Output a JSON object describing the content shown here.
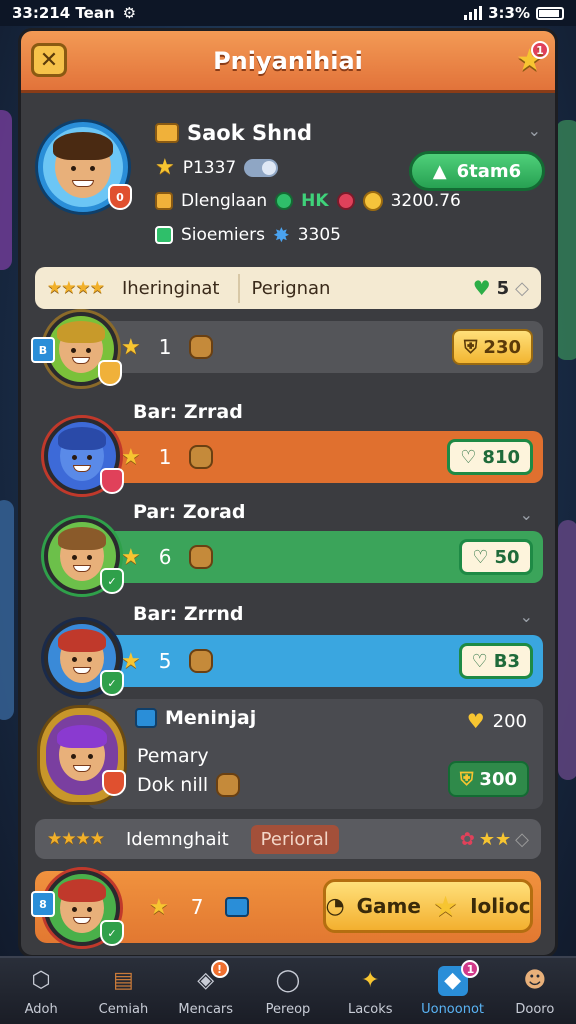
{
  "status_bar": {
    "time": "33:214 Tean",
    "battery": "3:3%"
  },
  "header": {
    "title": "Pniyanihiai",
    "notification_count": "1"
  },
  "profile": {
    "name": "Saok Shnd",
    "points": "P1337",
    "guild_label": "Dlenglaan",
    "gems_text": "HK",
    "gold": "3200.76",
    "shield_label": "Sioemiers",
    "stars_count": "3305",
    "action_label": "6tam6"
  },
  "tabs_top": {
    "stars": "★★★★",
    "label_a": "Iheringinat",
    "label_b": "Perignan",
    "count": "5"
  },
  "rows": [
    {
      "name": "",
      "rank": "1",
      "value": "230",
      "color": "#545559",
      "pill": "gold",
      "badge_text": "B"
    },
    {
      "name": "Bar: Zrrad",
      "rank": "1",
      "value": "810",
      "color": "#e0702f",
      "pill": "white"
    },
    {
      "name": "Par: Zorad",
      "rank": "6",
      "value": "50",
      "color": "#3ba45a",
      "pill": "white"
    },
    {
      "name": "Bar: Zrrnd",
      "rank": "5",
      "value": "B3",
      "color": "#3aa6e0",
      "pill": "white"
    }
  ],
  "featured": {
    "name": "Meninjaj",
    "line1": "Pemary",
    "line2": "Dok nill",
    "gold": "200",
    "value": "300"
  },
  "tabs_bottom": {
    "stars": "★★★★",
    "label_a": "Idemnghait",
    "label_b": "Perioral"
  },
  "footer_row": {
    "rank": "7",
    "button_left": "Game",
    "button_right": "Iolioc",
    "badge_text": "8"
  },
  "nav": [
    {
      "label": "Adoh",
      "icon": "⬡"
    },
    {
      "label": "Cemiah",
      "icon": "▤"
    },
    {
      "label": "Mencars",
      "icon": "◈",
      "badge": "!"
    },
    {
      "label": "Pereop",
      "icon": "◯"
    },
    {
      "label": "Lacoks",
      "icon": "✦"
    },
    {
      "label": "Uonoonot",
      "icon": "◆",
      "badge": "1",
      "active": true
    },
    {
      "label": "Dooro",
      "icon": "☻"
    }
  ],
  "colors": {
    "accent_orange": "#e2733a",
    "green": "#27a152",
    "blue": "#3aa6e0",
    "gold": "#f7c531"
  }
}
